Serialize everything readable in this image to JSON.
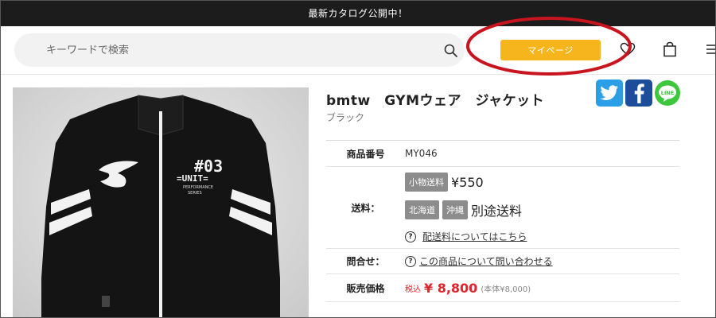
{
  "announcement": "最新カタログ公開中！",
  "header": {
    "search_placeholder": "キーワードで検索",
    "mypage_label": "マイページ"
  },
  "product": {
    "title": "bmtw　GYMウェア　ジャケット",
    "color": "ブラック",
    "image_print": {
      "number": "#03",
      "unit": "=UNIT=",
      "sub1": "PERFORMANCE",
      "sub2": "SERIES"
    }
  },
  "spec": {
    "item_number_label": "商品番号",
    "item_number": "MY046",
    "shipping_label": "送料：",
    "shipping_small_badge": "小物送料",
    "shipping_small_price": "¥550",
    "region_badges": [
      "北海道",
      "沖縄"
    ],
    "region_note": "別途送料",
    "shipping_link": "配送料についてはこちら",
    "inquiry_label": "問合せ：",
    "inquiry_link": "この商品について問い合わせる",
    "price_label": "販売価格",
    "tax_label": "税込",
    "price": "¥ 8,800",
    "price_note": "(本体¥8,000)"
  },
  "share": {
    "line_label": "LINE"
  },
  "colors": {
    "accent_yellow": "#f6b51c",
    "price_red": "#e0242c",
    "annotation_red": "#c8141e",
    "twitter": "#2a9ee6",
    "facebook": "#1b4d9a",
    "line": "#3cc73c"
  }
}
